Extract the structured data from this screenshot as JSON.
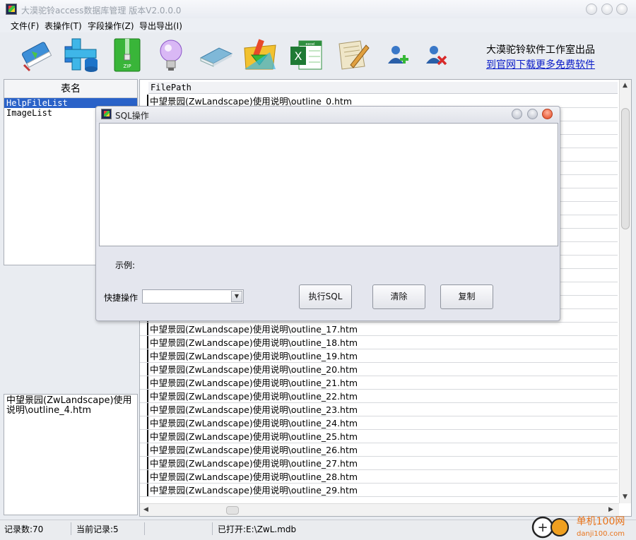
{
  "window": {
    "title": "大漠驼铃access数据库管理 版本V2.0.0.0"
  },
  "menu": [
    "文件(F)",
    "表操作(T)",
    "字段操作(Z)",
    "导出导出(I)"
  ],
  "toolbar": {
    "icons": [
      "open-database-icon",
      "add-table-icon",
      "compress-zip-icon",
      "lightbulb-icon",
      "book-icon",
      "import-folder-icon",
      "excel-export-icon",
      "edit-document-icon",
      "add-user-icon",
      "remove-user-icon"
    ],
    "studio_text": "大漠驼铃软件工作室出品",
    "studio_link": "到官网下载更多免费软件"
  },
  "tables_panel": {
    "header": "表名",
    "items": [
      {
        "label": "HelpFileList",
        "selected": true
      },
      {
        "label": "ImageList",
        "selected": false
      }
    ]
  },
  "detail_text": "中望景园(ZwLandscape)使用说明\\outline_4.htm",
  "grid": {
    "column_header": "FilePath",
    "rows": [
      "中望景园(ZwLandscape)使用说明\\outline_0.htm",
      "",
      "",
      "",
      "",
      "",
      "",
      "",
      "",
      "",
      "",
      "",
      "",
      "",
      "",
      "",
      "",
      "中望景园(ZwLandscape)使用说明\\outline_17.htm",
      "中望景园(ZwLandscape)使用说明\\outline_18.htm",
      "中望景园(ZwLandscape)使用说明\\outline_19.htm",
      "中望景园(ZwLandscape)使用说明\\outline_20.htm",
      "中望景园(ZwLandscape)使用说明\\outline_21.htm",
      "中望景园(ZwLandscape)使用说明\\outline_22.htm",
      "中望景园(ZwLandscape)使用说明\\outline_23.htm",
      "中望景园(ZwLandscape)使用说明\\outline_24.htm",
      "中望景园(ZwLandscape)使用说明\\outline_25.htm",
      "中望景园(ZwLandscape)使用说明\\outline_26.htm",
      "中望景园(ZwLandscape)使用说明\\outline_27.htm",
      "中望景园(ZwLandscape)使用说明\\outline_28.htm",
      "中望景园(ZwLandscape)使用说明\\outline_29.htm"
    ]
  },
  "statusbar": {
    "record_count": "记录数:70",
    "current_record": "当前记录:5",
    "opened_file": "已打开:E:\\ZwL.mdb"
  },
  "dialog": {
    "title": "SQL操作",
    "sql_value": "",
    "example_label": "示例:",
    "quick_label": "快捷操作",
    "quick_value": "",
    "execute_label": "执行SQL",
    "clear_label": "清除",
    "copy_label": "复制"
  },
  "watermark": {
    "text": "单机100网",
    "url": "danji100.com"
  }
}
